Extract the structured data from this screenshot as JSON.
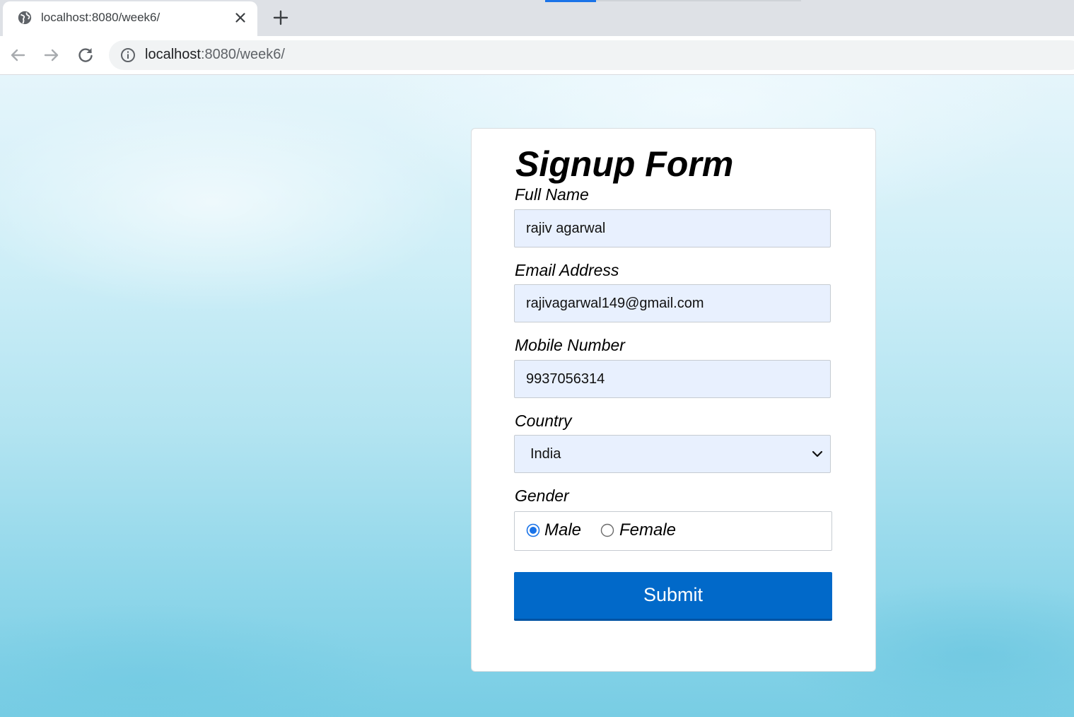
{
  "browser": {
    "tab_title": "localhost:8080/week6/",
    "url_host": "localhost",
    "url_rest": ":8080/week6/"
  },
  "form": {
    "title": "Signup Form",
    "full_name_label": "Full Name",
    "full_name_value": "rajiv agarwal",
    "email_label": "Email Address",
    "email_value": "rajivagarwal149@gmail.com",
    "mobile_label": "Mobile Number",
    "mobile_value": "9937056314",
    "country_label": "Country",
    "country_value": "India",
    "gender_label": "Gender",
    "gender_options": [
      "Male",
      "Female"
    ],
    "gender_selected": "Male",
    "submit_label": "Submit"
  },
  "colors": {
    "accent": "#0169c9",
    "input_bg": "#e8f0fe",
    "radio_checked": "#1a73e8"
  },
  "icons": {
    "favicon": "globe-icon",
    "tab_close": "close-icon",
    "new_tab": "plus-icon",
    "back": "arrow-left-icon",
    "forward": "arrow-right-icon",
    "reload": "reload-icon",
    "site_info": "info-icon",
    "select": "chevron-down-icon"
  }
}
